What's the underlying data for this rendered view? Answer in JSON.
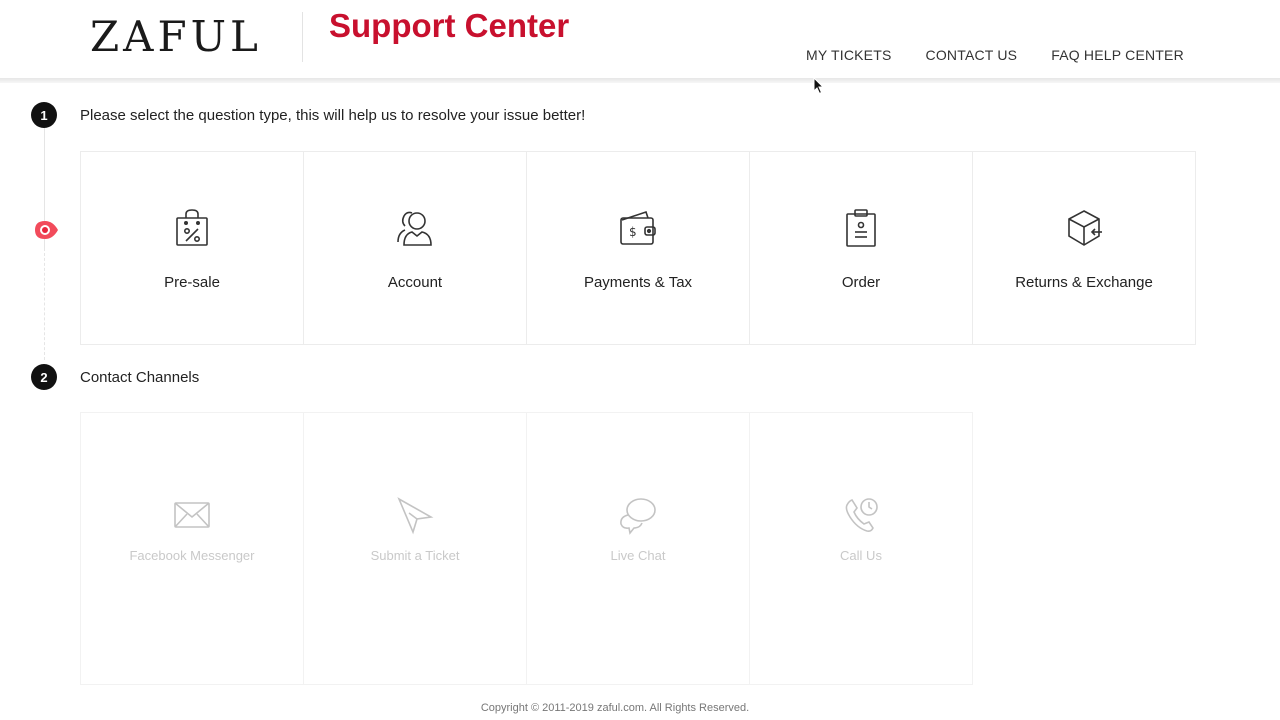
{
  "header": {
    "logo": "ZAFUL",
    "title": "Support Center",
    "nav": [
      "MY TICKETS",
      "CONTACT US",
      "FAQ HELP CENTER"
    ]
  },
  "step1": {
    "number": "1",
    "text": "Please select the question type, this will help us to resolve your issue better!",
    "categories": [
      {
        "label": "Pre-sale",
        "icon": "shopping-bag-percent-icon"
      },
      {
        "label": "Account",
        "icon": "users-icon"
      },
      {
        "label": "Payments & Tax",
        "icon": "wallet-icon"
      },
      {
        "label": "Order",
        "icon": "clipboard-icon"
      },
      {
        "label": "Returns & Exchange",
        "icon": "box-return-icon"
      }
    ]
  },
  "step2": {
    "number": "2",
    "text": "Contact Channels",
    "channels": [
      {
        "label": "Facebook Messenger",
        "icon": "envelope-icon"
      },
      {
        "label": "Submit a Ticket",
        "icon": "paper-plane-icon"
      },
      {
        "label": "Live Chat",
        "icon": "chat-bubbles-icon"
      },
      {
        "label": "Call Us",
        "icon": "phone-icon"
      }
    ]
  },
  "footer": {
    "copyright": "Copyright © 2011-2019 zaful.com. All Rights Reserved."
  },
  "colors": {
    "brand": "#c8102e",
    "step_bg": "#111111"
  }
}
